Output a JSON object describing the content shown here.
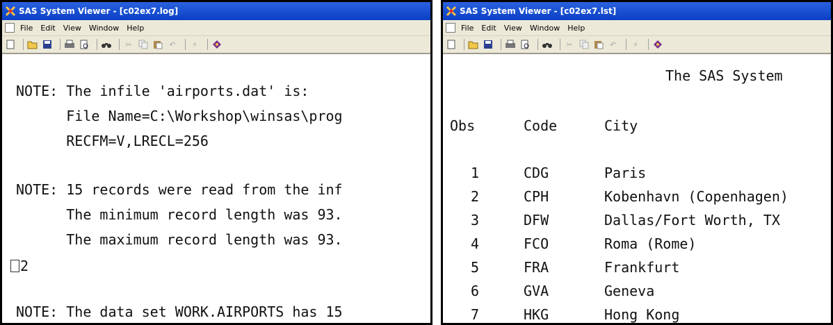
{
  "left_window": {
    "title": "SAS System Viewer - [c02ex7.log]",
    "menu": [
      "File",
      "Edit",
      "View",
      "Window",
      "Help"
    ],
    "log_lines": [
      "NOTE: The infile 'airports.dat' is:",
      "      File Name=C:\\Workshop\\winsas\\prog",
      "      RECFM=V,LRECL=256",
      "NOTE: 15 records were read from the inf",
      "      The minimum record length was 93.",
      "      The maximum record length was 93.",
      "2",
      "NOTE: The data set WORK.AIRPORTS has 15"
    ]
  },
  "right_window": {
    "title": "SAS System Viewer - [c02ex7.lst]",
    "menu": [
      "File",
      "Edit",
      "View",
      "Window",
      "Help"
    ],
    "report_title": "The SAS System",
    "columns": [
      "Obs",
      "Code",
      "City"
    ],
    "rows": [
      {
        "obs": "1",
        "code": "CDG",
        "city": "Paris"
      },
      {
        "obs": "2",
        "code": "CPH",
        "city": "Kobenhavn (Copenhagen)"
      },
      {
        "obs": "3",
        "code": "DFW",
        "city": "Dallas/Fort Worth, TX"
      },
      {
        "obs": "4",
        "code": "FCO",
        "city": "Roma (Rome)"
      },
      {
        "obs": "5",
        "code": "FRA",
        "city": "Frankfurt"
      },
      {
        "obs": "6",
        "code": "GVA",
        "city": "Geneva"
      },
      {
        "obs": "7",
        "code": "HKG",
        "city": "Hong Kong"
      }
    ]
  },
  "toolbar_icons": [
    "new-icon",
    "open-icon",
    "save-icon",
    "print-icon",
    "print-preview-icon",
    "find-icon",
    "cut-icon",
    "copy-icon",
    "paste-icon",
    "undo-icon",
    "clear-icon",
    "help-book-icon"
  ]
}
